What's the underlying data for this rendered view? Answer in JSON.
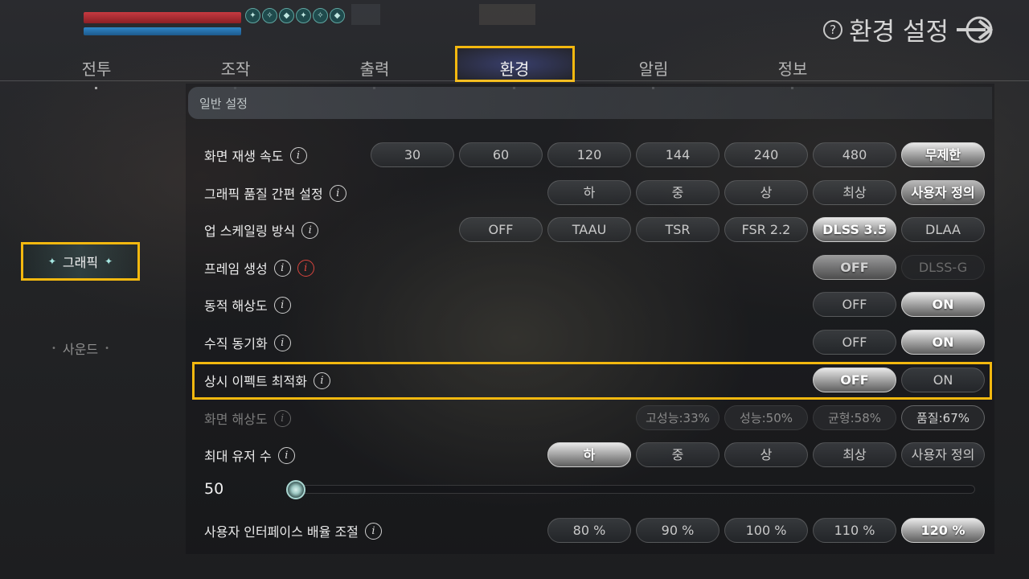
{
  "page": {
    "title": "환경 설정",
    "help_icon": "?"
  },
  "tabs": [
    {
      "label": "전투"
    },
    {
      "label": "조작"
    },
    {
      "label": "출력"
    },
    {
      "label": "환경",
      "active": true
    },
    {
      "label": "알림"
    },
    {
      "label": "정보"
    }
  ],
  "sidebar": {
    "items": [
      {
        "label": "그래픽",
        "active": true
      },
      {
        "label": "사운드",
        "active": false
      }
    ]
  },
  "section": {
    "title": "일반 설정"
  },
  "rows": {
    "frame_rate": {
      "label": "화면 재생 속도",
      "options": [
        "30",
        "60",
        "120",
        "144",
        "240",
        "480",
        "무제한"
      ],
      "selected": "무제한"
    },
    "quality": {
      "label": "그래픽 품질 간편 설정",
      "options": [
        "하",
        "중",
        "상",
        "최상",
        "사용자 정의"
      ],
      "selected": "사용자 정의"
    },
    "upscale": {
      "label": "업 스케일링 방식",
      "options": [
        "OFF",
        "TAAU",
        "TSR",
        "FSR 2.2",
        "DLSS 3.5",
        "DLAA"
      ],
      "selected": "DLSS 3.5"
    },
    "frame_gen": {
      "label": "프레임 생성",
      "options": [
        "OFF",
        "DLSS-G"
      ],
      "selected": "OFF"
    },
    "dynamic_res": {
      "label": "동적 해상도",
      "options": [
        "OFF",
        "ON"
      ],
      "selected": "ON"
    },
    "vsync": {
      "label": "수직 동기화",
      "options": [
        "OFF",
        "ON"
      ],
      "selected": "ON"
    },
    "effect_opt": {
      "label": "상시 이펙트 최적화",
      "options": [
        "OFF",
        "ON"
      ],
      "selected": "OFF"
    },
    "screen_res": {
      "label": "화면 해상도",
      "options": [
        "고성능:33%",
        "성능:50%",
        "균형:58%",
        "품질:67%"
      ],
      "selected": "품질:67%"
    },
    "max_users": {
      "label": "최대 유저 수",
      "options": [
        "하",
        "중",
        "상",
        "최상",
        "사용자 정의"
      ],
      "selected": "하",
      "slider_value": "50",
      "slider_fraction": 0.0
    },
    "ui_scale": {
      "label": "사용자 인터페이스 배율 조절",
      "options": [
        "80 %",
        "90 %",
        "100 %",
        "110 %",
        "120 %"
      ],
      "selected": "120 %"
    }
  },
  "colors": {
    "highlight": "#f3b80f",
    "hp": "#c63a40",
    "mp": "#2f86c8",
    "accent": "#a7e8e3"
  }
}
